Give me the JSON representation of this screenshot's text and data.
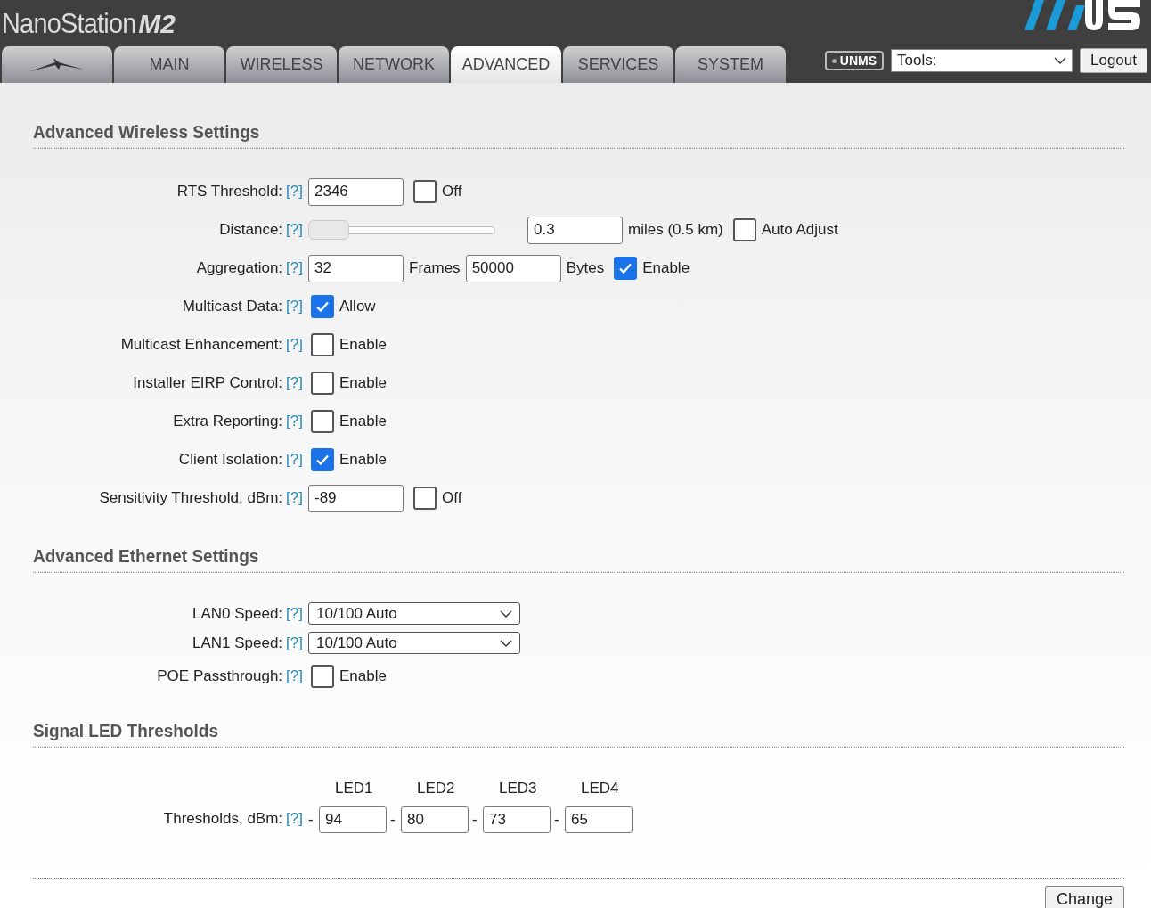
{
  "header": {
    "product": "NanoStation",
    "model": "M2",
    "unms": "UNMS",
    "tools": "Tools:",
    "logout": "Logout"
  },
  "tabs": [
    {
      "kind": "icon",
      "selected": false
    },
    {
      "kind": "text",
      "label": "MAIN",
      "selected": false
    },
    {
      "kind": "text",
      "label": "WIRELESS",
      "selected": false
    },
    {
      "kind": "text",
      "label": "NETWORK",
      "selected": false
    },
    {
      "kind": "text",
      "label": "ADVANCED",
      "selected": true
    },
    {
      "kind": "text",
      "label": "SERVICES",
      "selected": false
    },
    {
      "kind": "text",
      "label": "SYSTEM",
      "selected": false
    }
  ],
  "sections": [
    {
      "title": "Advanced Wireless Settings",
      "rows": [
        {
          "label": "RTS Threshold:",
          "help": "[?]",
          "controls": [
            {
              "kind": "input",
              "value": "2346"
            },
            {
              "kind": "checkbox",
              "checked": false,
              "label": "Off"
            }
          ]
        },
        {
          "label": "Distance:",
          "help": "[?]",
          "controls": [
            {
              "kind": "slider",
              "level": 0
            },
            {
              "kind": "input",
              "value": "0.3"
            },
            {
              "kind": "text",
              "text": "miles (0.5 km)"
            },
            {
              "kind": "checkbox",
              "checked": false,
              "label": "Auto Adjust"
            }
          ]
        },
        {
          "label": "Aggregation:",
          "help": "[?]",
          "controls": [
            {
              "kind": "input",
              "value": "32"
            },
            {
              "kind": "text",
              "text": "Frames"
            },
            {
              "kind": "input",
              "value": "50000"
            },
            {
              "kind": "text",
              "text": "Bytes"
            },
            {
              "kind": "checkbox",
              "checked": true,
              "label": "Enable"
            }
          ]
        },
        {
          "label": "Multicast Data:",
          "help": "[?]",
          "controls": [
            {
              "kind": "checkbox",
              "checked": true,
              "label": "Allow"
            }
          ]
        },
        {
          "label": "Multicast Enhancement:",
          "help": "[?]",
          "controls": [
            {
              "kind": "checkbox",
              "checked": false,
              "label": "Enable"
            }
          ]
        },
        {
          "label": "Installer EIRP Control:",
          "help": "[?]",
          "controls": [
            {
              "kind": "checkbox",
              "checked": false,
              "label": "Enable"
            }
          ]
        },
        {
          "label": "Extra Reporting:",
          "help": "[?]",
          "controls": [
            {
              "kind": "checkbox",
              "checked": false,
              "label": "Enable"
            }
          ]
        },
        {
          "label": "Client Isolation:",
          "help": "[?]",
          "controls": [
            {
              "kind": "checkbox",
              "checked": true,
              "label": "Enable"
            }
          ]
        },
        {
          "label": "Sensitivity Threshold, dBm:",
          "help": "[?]",
          "controls": [
            {
              "kind": "input",
              "value": "-89"
            },
            {
              "kind": "checkbox",
              "checked": false,
              "label": "Off"
            }
          ]
        }
      ]
    },
    {
      "title": "Advanced Ethernet Settings",
      "rows": [
        {
          "label": "LAN0 Speed:",
          "help": "[?]",
          "controls": [
            {
              "kind": "select",
              "value": "10/100 Auto"
            }
          ]
        },
        {
          "label": "LAN1 Speed:",
          "help": "[?]",
          "controls": [
            {
              "kind": "select",
              "value": "10/100 Auto"
            }
          ]
        },
        {
          "label": "POE Passthrough:",
          "help": "[?]",
          "controls": [
            {
              "kind": "checkbox",
              "checked": false,
              "label": "Enable"
            }
          ]
        }
      ]
    },
    {
      "title": "Signal LED Thresholds",
      "leds": {
        "label": "Thresholds, dBm:",
        "help": "[?]",
        "items": [
          {
            "header": "LED1",
            "sep": "-",
            "value": "94"
          },
          {
            "header": "LED2",
            "sep": "-",
            "value": "80"
          },
          {
            "header": "LED3",
            "sep": "-",
            "value": "73"
          },
          {
            "header": "LED4",
            "sep": "-",
            "value": "65"
          }
        ]
      }
    }
  ],
  "change_button": "Change"
}
